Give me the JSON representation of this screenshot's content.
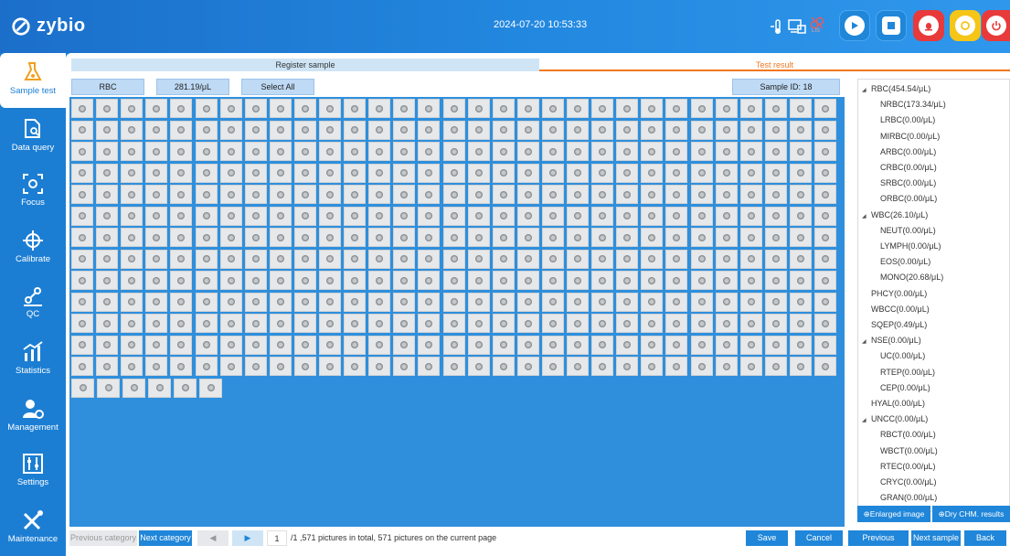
{
  "header": {
    "logo_text": "zybio",
    "datetime": "2024-07-20 10:53:33",
    "status_icons": [
      "thermometer-icon",
      "computer-icon",
      "link-off-icon"
    ],
    "status_sub": "LIS",
    "buttons": [
      {
        "name": "play-icon",
        "color": "#1f86d9"
      },
      {
        "name": "stop-icon",
        "color": "#1f86d9"
      },
      {
        "name": "alarm-icon",
        "color": "#e83a3a"
      },
      {
        "name": "refresh-icon",
        "color": "#f5c518"
      },
      {
        "name": "power-icon",
        "color": "#e83a3a"
      }
    ]
  },
  "sidebar": {
    "items": [
      {
        "label": "Sample test",
        "icon": "flask-icon",
        "active": true
      },
      {
        "label": "Data query",
        "icon": "document-search-icon"
      },
      {
        "label": "Focus",
        "icon": "focus-icon"
      },
      {
        "label": "Calibrate",
        "icon": "crosshair-icon"
      },
      {
        "label": "QC",
        "icon": "qc-icon"
      },
      {
        "label": "Statistics",
        "icon": "chart-icon"
      },
      {
        "label": "Management",
        "icon": "user-gear-icon"
      },
      {
        "label": "Settings",
        "icon": "sliders-icon"
      },
      {
        "label": "Maintenance",
        "icon": "tools-icon"
      }
    ]
  },
  "tabs": {
    "register": "Register sample",
    "result": "Test result"
  },
  "toolbar": {
    "category": "RBC",
    "concentration": "281.19/μL",
    "select_all": "Select All",
    "sample_id_label": "Sample ID:",
    "sample_id": "18"
  },
  "gallery": {
    "total_pictures": 571,
    "visible_cells": 409
  },
  "bottom": {
    "prev_category": "Previous category",
    "next_category": "Next category",
    "page_current": "1",
    "page_info": "/1 ,571 pictures in total, 571 pictures on the current page",
    "save": "Save",
    "cancel": "Cancel",
    "prev_sample": "Previous sample",
    "next_sample": "Next sample",
    "back": "Back"
  },
  "tree": [
    {
      "text": "RBC(454.54/μL)",
      "level": 0,
      "expandable": true
    },
    {
      "text": "NRBC(173.34/μL)",
      "level": 1
    },
    {
      "text": "LRBC(0.00/μL)",
      "level": 1
    },
    {
      "text": "MIRBC(0.00/μL)",
      "level": 1
    },
    {
      "text": "ARBC(0.00/μL)",
      "level": 1
    },
    {
      "text": "CRBC(0.00/μL)",
      "level": 1
    },
    {
      "text": "SRBC(0.00/μL)",
      "level": 1
    },
    {
      "text": "ORBC(0.00/μL)",
      "level": 1
    },
    {
      "text": "WBC(26.10/μL)",
      "level": 0,
      "expandable": true
    },
    {
      "text": "NEUT(0.00/μL)",
      "level": 1
    },
    {
      "text": "LYMPH(0.00/μL)",
      "level": 1
    },
    {
      "text": "EOS(0.00/μL)",
      "level": 1
    },
    {
      "text": "MONO(20.68/μL)",
      "level": 1
    },
    {
      "text": "PHCY(0.00/μL)",
      "level": 0
    },
    {
      "text": "WBCC(0.00/μL)",
      "level": 0
    },
    {
      "text": "SQEP(0.49/μL)",
      "level": 0
    },
    {
      "text": "NSE(0.00/μL)",
      "level": 0,
      "expandable": true
    },
    {
      "text": "UC(0.00/μL)",
      "level": 1
    },
    {
      "text": "RTEP(0.00/μL)",
      "level": 1
    },
    {
      "text": "CEP(0.00/μL)",
      "level": 1
    },
    {
      "text": "HYAL(0.00/μL)",
      "level": 0
    },
    {
      "text": "UNCC(0.00/μL)",
      "level": 0,
      "expandable": true
    },
    {
      "text": "RBCT(0.00/μL)",
      "level": 1
    },
    {
      "text": "WBCT(0.00/μL)",
      "level": 1
    },
    {
      "text": "RTEC(0.00/μL)",
      "level": 1
    },
    {
      "text": "CRYC(0.00/μL)",
      "level": 1
    },
    {
      "text": "GRAN(0.00/μL)",
      "level": 1
    }
  ],
  "tree_actions": {
    "enlarge": "Enlarged image",
    "dry_chm": "Dry CHM. results"
  }
}
